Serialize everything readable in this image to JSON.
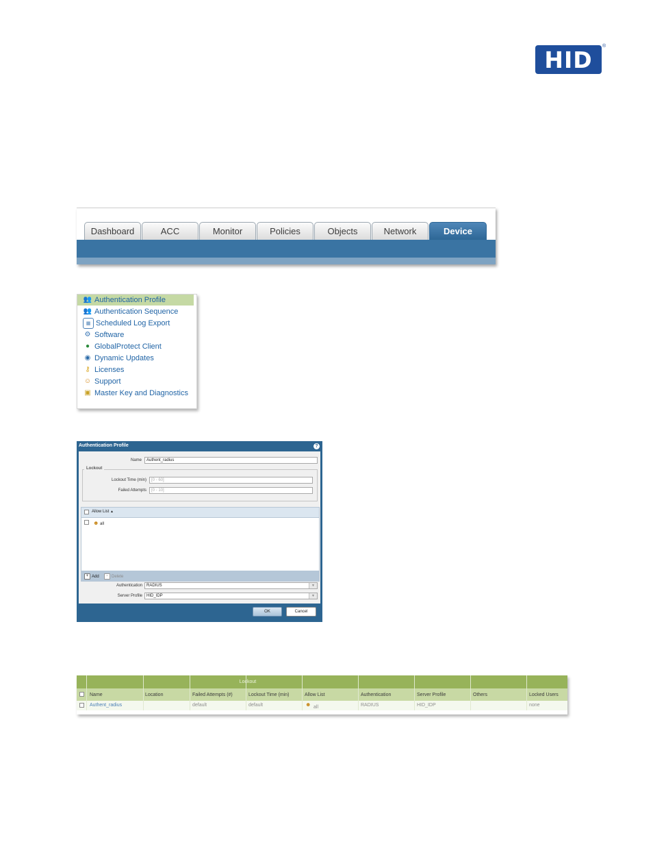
{
  "logo": {
    "text": "HID",
    "mark": "®"
  },
  "nav_tabs": [
    {
      "label": "Dashboard",
      "active": false
    },
    {
      "label": "ACC",
      "active": false
    },
    {
      "label": "Monitor",
      "active": false
    },
    {
      "label": "Policies",
      "active": false
    },
    {
      "label": "Objects",
      "active": false
    },
    {
      "label": "Network",
      "active": false
    },
    {
      "label": "Device",
      "active": true
    }
  ],
  "device_menu": [
    {
      "label": "Authentication Profile",
      "icon": "users-icon",
      "selected": true
    },
    {
      "label": "Authentication Sequence",
      "icon": "users-sequence-icon",
      "selected": false
    },
    {
      "label": "Scheduled Log Export",
      "icon": "calendar-icon",
      "selected": false
    },
    {
      "label": "Software",
      "icon": "software-icon",
      "selected": false
    },
    {
      "label": "GlobalProtect Client",
      "icon": "globe-icon",
      "selected": false
    },
    {
      "label": "Dynamic Updates",
      "icon": "update-icon",
      "selected": false
    },
    {
      "label": "Licenses",
      "icon": "key-icon",
      "selected": false
    },
    {
      "label": "Support",
      "icon": "support-icon",
      "selected": false
    },
    {
      "label": "Master Key and Diagnostics",
      "icon": "lock-icon",
      "selected": false
    }
  ],
  "dialog": {
    "title": "Authentication Profile",
    "name_label": "Name",
    "name_value": "Authent_radius",
    "lockout_legend": "Lockout",
    "lockout_time_label": "Lockout Time (min)",
    "lockout_time_placeholder": "[0 - 60]",
    "failed_attempts_label": "Failed Attempts",
    "failed_attempts_placeholder": "[0 - 10]",
    "allow_list_header": "Allow List",
    "sort_indicator": "▲",
    "allow_list_items": [
      "all"
    ],
    "add_label": "Add",
    "delete_label": "Delete",
    "authentication_label": "Authentication",
    "authentication_value": "RADIUS",
    "server_profile_label": "Server Profile",
    "server_profile_value": "HID_IDP",
    "ok_label": "OK",
    "cancel_label": "Cancel"
  },
  "profiles_table": {
    "group_header": "Lockout",
    "columns": [
      "Name",
      "Location",
      "Failed Attempts (#)",
      "Lockout Time (min)",
      "Allow List",
      "Authentication",
      "Server Profile",
      "Others",
      "Locked Users"
    ],
    "rows": [
      {
        "name": "Authent_radius",
        "location": "",
        "failed_attempts": "default",
        "lockout_time": "default",
        "allow_list": "all",
        "authentication": "RADIUS",
        "server_profile": "HID_IDP",
        "others": "",
        "locked_users": "none"
      }
    ]
  },
  "colors": {
    "hid_blue": "#1f4e9c",
    "tab_active": "#2e6796",
    "menu_selected": "#c5d9a4",
    "dialog_frame": "#2d6591",
    "table_header": "#97b35a"
  }
}
